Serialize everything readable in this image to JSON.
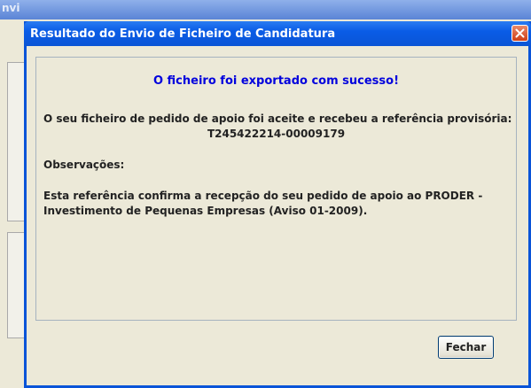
{
  "background_window": {
    "title_fragment": "nvi"
  },
  "dialog": {
    "title": "Resultado do Envio de Ficheiro de Candidatura",
    "close_icon": "close-icon",
    "message_title": "O ficheiro foi exportado com sucesso!",
    "line1": "O seu ficheiro de pedido de apoio foi aceite e recebeu a referência provisória:",
    "reference": "T245422214-00009179",
    "observations_label": "Observações:",
    "description_line1": "Esta referência confirma a recepção do seu pedido de apoio ao PRODER -",
    "description_line2": "Investimento de Pequenas Empresas (Aviso 01-2009).",
    "button_label": "Fechar"
  },
  "colors": {
    "title_bar": "#0a55d6",
    "message_title": "#0000dd",
    "close_button": "#cf3e16",
    "dialog_background": "#ece9d8"
  }
}
